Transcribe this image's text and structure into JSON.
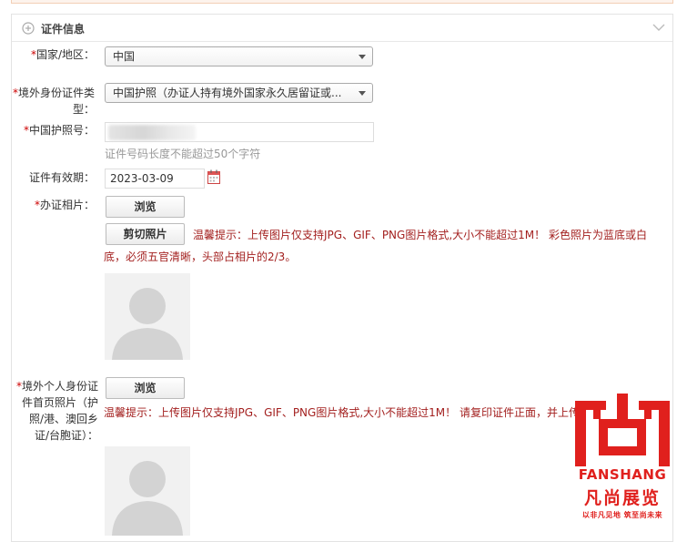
{
  "section": {
    "title": "证件信息"
  },
  "fields": {
    "country": {
      "label": "国家/地区：",
      "value": "中国"
    },
    "id_type": {
      "label_line1": "境外身份证件类",
      "label_line2": "型：",
      "value": "中国护照（办证人持有境外国家永久居留证或..."
    },
    "passport_no": {
      "label": "中国护照号：",
      "hint": "证件号码长度不能超过50个字符"
    },
    "validity": {
      "label": "证件有效期：",
      "value": "2023-03-09"
    },
    "photo": {
      "label": "办证相片：",
      "browse": "浏览",
      "crop": "剪切照片",
      "hint_line1": "温馨提示：上传图片仅支持JPG、GIF、PNG图片格式,大小不能超过1M！ 彩色照片为蓝底或白",
      "hint_line2": "底，必须五官清晰，头部占相片的2/3。"
    },
    "overseas_doc": {
      "label_line1": "境外个人身份证",
      "label_line2": "件首页照片（护",
      "label_line3": "照/港、澳回乡",
      "label_line4": "证/台胞证）：",
      "browse": "浏览",
      "hint": "温馨提示：上传图片仅支持JPG、GIF、PNG图片格式,大小不能超过1M！ 请复印证件正面，并上传"
    }
  },
  "watermark": {
    "brand": "FANSHANG",
    "brand_cn": "凡尚展览",
    "slogan": "以非凡见地 筑至尚未来"
  },
  "colors": {
    "required": "#cc0000",
    "warning": "#a3201f",
    "brand": "#e0201d"
  }
}
